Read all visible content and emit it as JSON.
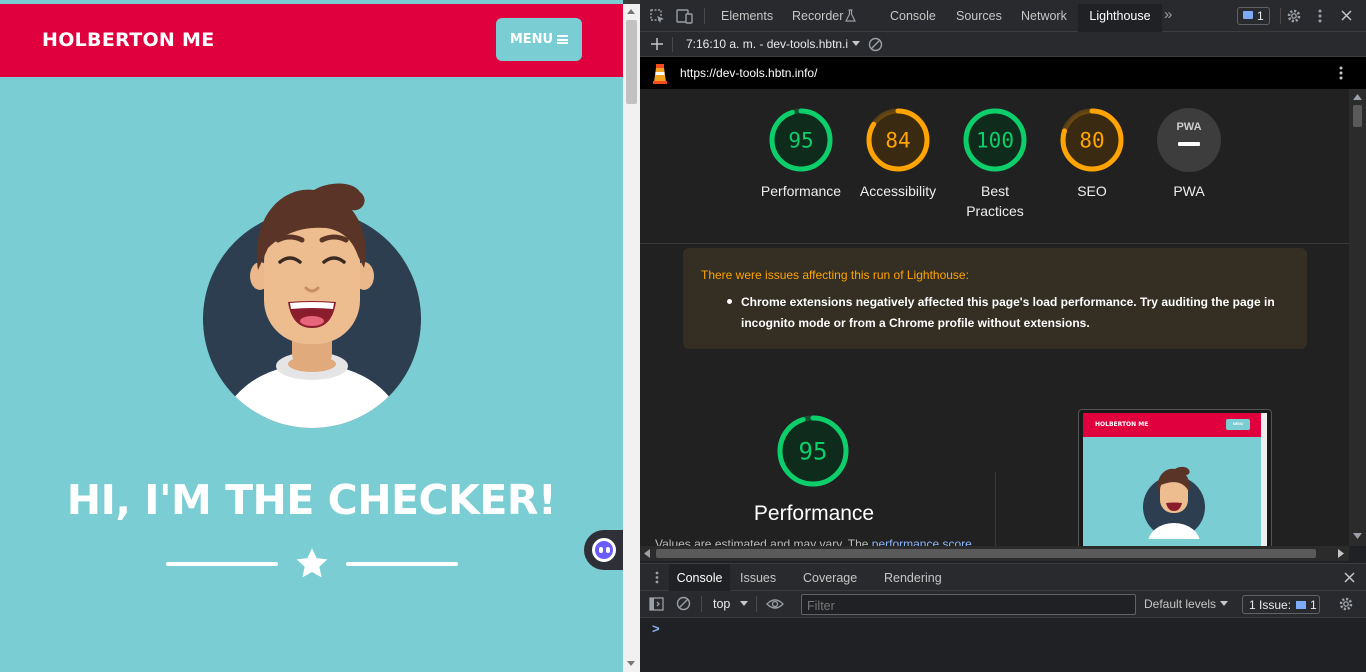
{
  "site": {
    "brand": "HOLBERTON ME",
    "menu_label": "MENU",
    "hero_title": "HI, I'M THE CHECKER!",
    "colors": {
      "header": "#e1003e",
      "background": "#79cdd3"
    }
  },
  "devtools": {
    "tabs": [
      "Elements",
      "Recorder",
      "Console",
      "Sources",
      "Network",
      "Lighthouse"
    ],
    "active_tab": "Lighthouse",
    "issues_count": "1",
    "report_select": "7:16:10 a. m. - dev-tools.hbtn.i",
    "lighthouse": {
      "url": "https://dev-tools.hbtn.info/",
      "scores": [
        {
          "label": "Performance",
          "value": "95",
          "score": 95,
          "color": "#0cce6b"
        },
        {
          "label": "Accessibility",
          "value": "84",
          "score": 84,
          "color": "#ffa400"
        },
        {
          "label": "Best Practices",
          "value": "100",
          "score": 100,
          "color": "#0cce6b"
        },
        {
          "label": "SEO",
          "value": "80",
          "score": 80,
          "color": "#ffa400"
        },
        {
          "label": "PWA",
          "value": "PWA",
          "score": null,
          "color": "#9aa0a6"
        }
      ],
      "warning_title": "There were issues affecting this run of Lighthouse:",
      "warning_items": [
        "Chrome extensions negatively affected this page's load performance. Try auditing the page in incognito mode or from a Chrome profile without extensions."
      ],
      "performance_section": {
        "score": "95",
        "title": "Performance",
        "note": "Values are estimated and may vary. The ",
        "note_link": "performance score"
      },
      "thumbnail": {
        "brand": "HOLBERTON ME",
        "menu": "MENU"
      }
    },
    "drawer": {
      "tabs": [
        "Console",
        "Issues",
        "Coverage",
        "Rendering"
      ],
      "active_tab": "Console",
      "context": "top",
      "filter_placeholder": "Filter",
      "levels_label": "Default levels",
      "issues_label": "1 Issue:",
      "issues_count": "1",
      "prompt": ">"
    }
  }
}
